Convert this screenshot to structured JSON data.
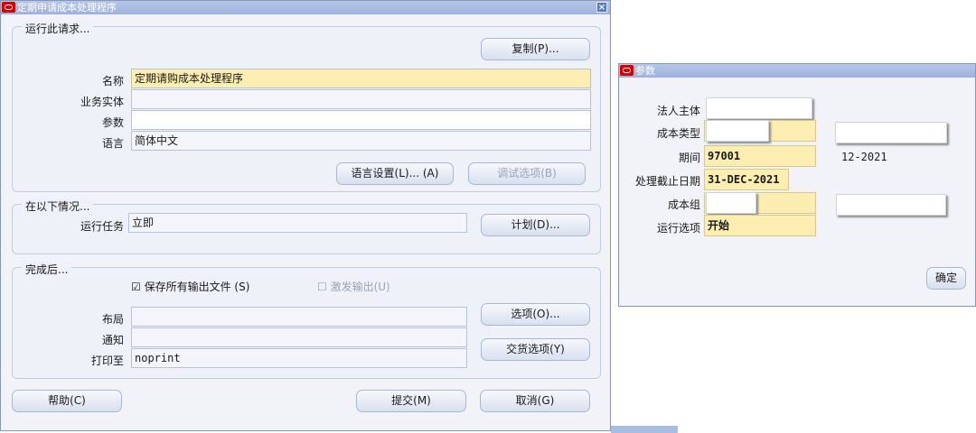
{
  "main_window": {
    "title": "定期申请成本处理程序",
    "close_icon": "x-icon",
    "run_request": {
      "group_title": "运行此请求...",
      "copy_button": "复制(P)...",
      "name_label": "名称",
      "name_value": "定期请购成本处理程序",
      "operating_unit_label": "业务实体",
      "operating_unit_value": "",
      "parameters_label": "参数",
      "parameters_value": "",
      "language_label": "语言",
      "language_value": "简体中文",
      "language_settings_button": "语言设置(L)... (A)",
      "debug_options_button": "调试选项(B)"
    },
    "conditions": {
      "group_title": "在以下情况...",
      "run_job_label": "运行任务",
      "run_job_value": "立即",
      "schedule_button": "计划(D)..."
    },
    "completion": {
      "group_title": "完成后...",
      "save_output_label": "保存所有输出文件 (S)",
      "save_output_checked": true,
      "burst_output_label": "激发输出(U)",
      "burst_output_checked": false,
      "layout_label": "布局",
      "layout_value": "",
      "notify_label": "通知",
      "notify_value": "",
      "print_to_label": "打印至",
      "print_to_value": "noprint",
      "options_button": "选项(O)...",
      "delivery_options_button": "交货选项(Y)"
    },
    "help_button": "帮助(C)",
    "submit_button": "提交(M)",
    "cancel_button": "取消(G)"
  },
  "params_window": {
    "title": "参数",
    "legal_entity_label": "法人主体",
    "legal_entity_value": "",
    "cost_type_label": "成本类型",
    "cost_type_value": "",
    "cost_type_desc": "",
    "period_label": "期间",
    "period_value": "97001",
    "period_desc": "12-2021",
    "cutoff_date_label": "处理截止日期",
    "cutoff_date_value": "31-DEC-2021",
    "cost_group_label": "成本组",
    "cost_group_value": "",
    "cost_group_desc": "",
    "run_options_label": "运行选项",
    "run_options_value": "开始",
    "ok_button": "确定"
  },
  "colors": {
    "required_field": "#fcedb0",
    "title_bar": "#a9bce2",
    "oracle_red": "#d40000"
  }
}
